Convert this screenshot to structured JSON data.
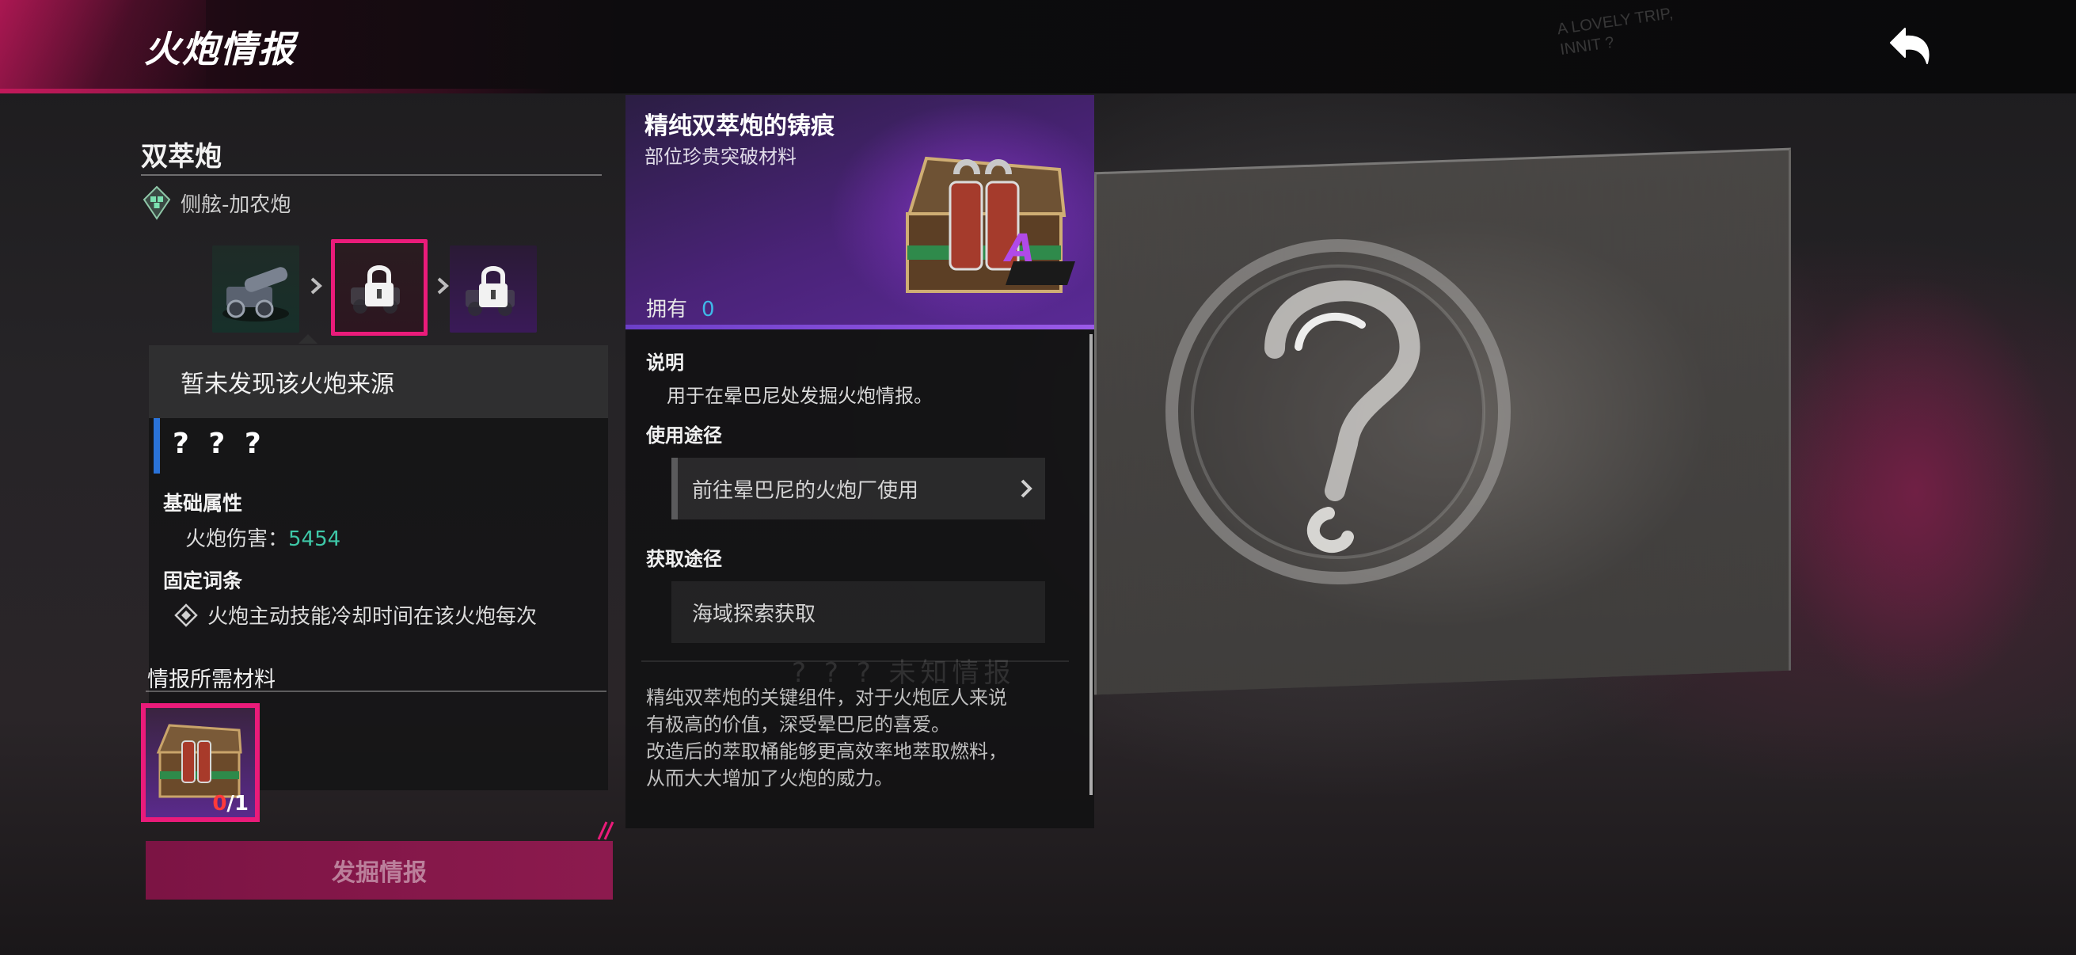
{
  "header": {
    "title": "火炮情报",
    "scribble": [
      "A LOVELY TRIP,",
      "INNIT ?"
    ]
  },
  "cannon": {
    "name": "双萃炮",
    "type": "侧舷-加农炮",
    "stages": [
      {
        "state": "unlocked"
      },
      {
        "state": "locked-selected"
      },
      {
        "state": "locked"
      }
    ],
    "source_text": "暂未发现该火炮来源",
    "unknown_name": "? ? ?",
    "base_attr_head": "基础属性",
    "damage_label": "火炮伤害：",
    "damage_value": "5454",
    "fixed_head": "固定词条",
    "fixed_text": "火炮主动技能冷却时间在该火炮每次"
  },
  "materials": {
    "head": "情报所需材料",
    "have": "0",
    "need": "/1",
    "button_label": "发掘情报"
  },
  "item": {
    "name": "精纯双萃炮的铸痕",
    "subtitle": "部位珍贵突破材料",
    "own_label": "拥有",
    "own_value": "0",
    "grade": "A",
    "desc_head": "说明",
    "desc_text": "用于在晕巴尼处发掘火炮情报。",
    "use_head": "使用途径",
    "use_route": "前往晕巴尼的火炮厂使用",
    "obtain_head": "获取途径",
    "obtain_route": "海域探索获取",
    "ghost_text": "? ? ?   未知情报",
    "flavor": [
      "精纯双萃炮的关键组件，对于火炮匠人来说",
      "有极高的价值，深受晕巴尼的喜爱。",
      "改造后的萃取桶能够更高效率地萃取燃料，",
      "从而大大增加了火炮的威力。"
    ]
  },
  "colors": {
    "accent_pink": "#ea1b7a",
    "damage_teal": "#3ec7a7",
    "own_blue": "#3fb8e8",
    "rarity_purple": "#5a2a96",
    "bar_blue": "#2a73d9"
  }
}
